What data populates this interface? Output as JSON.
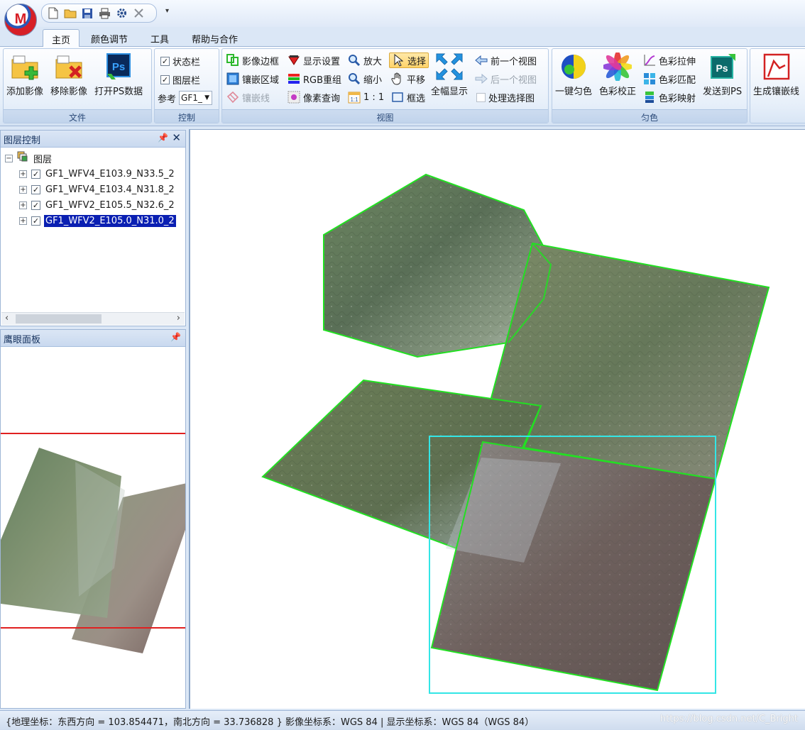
{
  "app": {
    "logo_letter": "M",
    "quick_access": [
      "new-file-icon",
      "open-folder-icon",
      "save-icon",
      "print-icon",
      "settings-icon",
      "close-icon"
    ],
    "qat_dropdown": "▾"
  },
  "tabs": [
    {
      "label": "主页",
      "active": true
    },
    {
      "label": "颜色调节"
    },
    {
      "label": "工具"
    },
    {
      "label": "帮助与合作"
    }
  ],
  "ribbon": {
    "file": {
      "label": "文件",
      "add_image": "添加影像",
      "remove_image": "移除影像",
      "open_ps": "打开PS数据"
    },
    "control": {
      "label": "控制",
      "status_bar": "状态栏",
      "layer_bar": "图层栏",
      "reference_label": "参考",
      "reference_value": "GF1_"
    },
    "view": {
      "label": "视图",
      "image_border": "影像边框",
      "mosaic_area": "镶嵌区域",
      "mosaic_line": "镶嵌线",
      "display_settings": "显示设置",
      "rgb_recombine": "RGB重组",
      "pixel_query": "像素查询",
      "zoom_in": "放大",
      "zoom_out": "缩小",
      "scale_1to1": "1 : 1",
      "select": "选择",
      "pan": "平移",
      "box_select": "框选",
      "full_extent": "全幅显示",
      "prev_view": "前一个视图",
      "next_view": "后一个视图",
      "process_selected": "处理选择图"
    },
    "color": {
      "label": "匀色",
      "one_key": "一键匀色",
      "correction": "色彩校正",
      "stretch": "色彩拉伸",
      "match": "色彩匹配",
      "mapping": "色彩映射",
      "send_ps": "发送到PS"
    },
    "mosaic": {
      "generate_line": "生成镶嵌线"
    }
  },
  "layer_panel": {
    "title": "图层控制",
    "root": "图层",
    "layers": [
      {
        "name": "GF1_WFV4_E103.9_N33.5_2",
        "checked": true,
        "selected": false
      },
      {
        "name": "GF1_WFV4_E103.4_N31.8_2",
        "checked": true,
        "selected": false
      },
      {
        "name": "GF1_WFV2_E105.5_N32.6_2",
        "checked": true,
        "selected": false
      },
      {
        "name": "GF1_WFV2_E105.0_N31.0_2",
        "checked": true,
        "selected": true
      }
    ]
  },
  "eagle_panel": {
    "title": "鹰眼面板"
  },
  "statusbar": {
    "text": "{地理坐标：东西方向 = 103.854471，南北方向 = 33.736828 } 影像坐标系：WGS 84 | 显示坐标系：WGS 84（WGS 84）",
    "watermark": "https://blog.csdn.net/C_Bright"
  },
  "colors": {
    "footprint_outline": "#22e022",
    "selection_outline": "#33e6e6",
    "eagle_view_line": "#e02020",
    "selected_layer": "#0a1fb2"
  }
}
